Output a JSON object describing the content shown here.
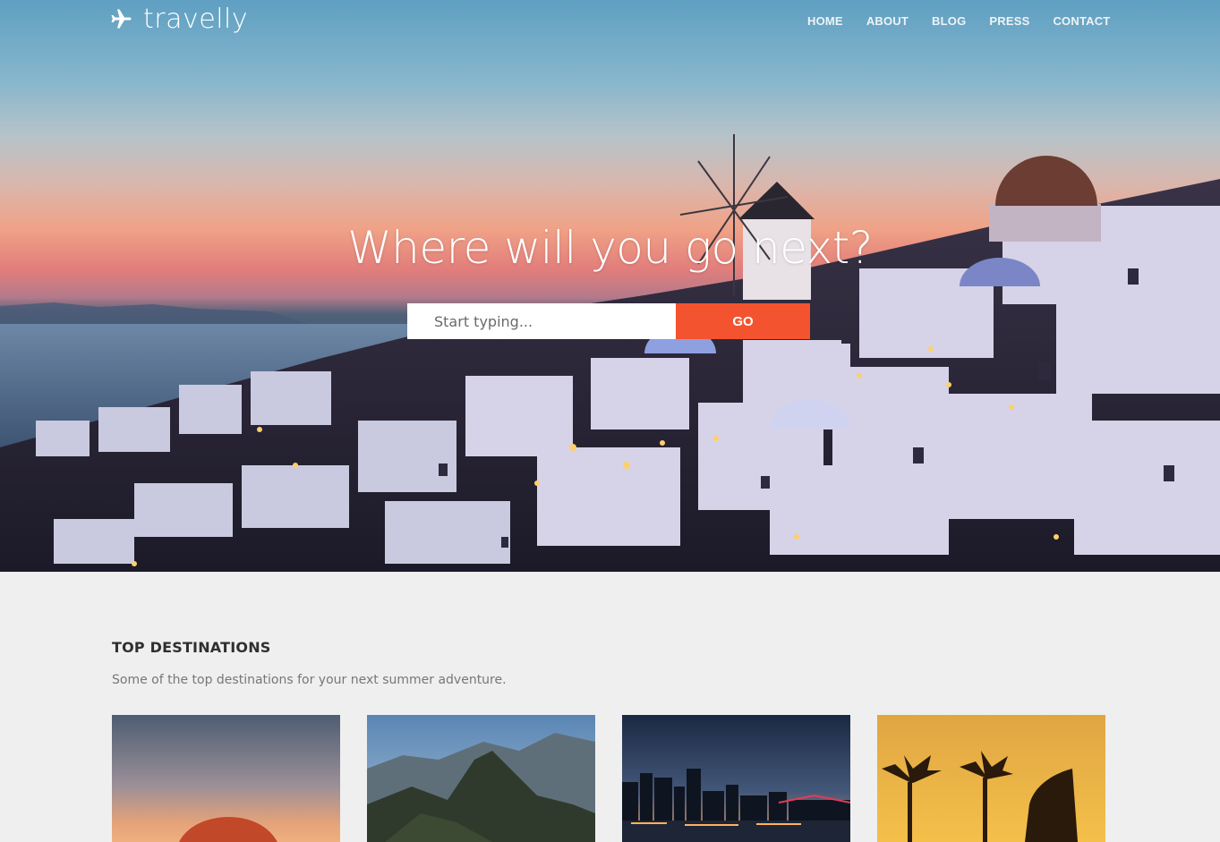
{
  "header": {
    "brand": "travelly",
    "logo_icon": "airplane-icon",
    "nav": [
      "HOME",
      "ABOUT",
      "BLOG",
      "PRESS",
      "CONTACT"
    ]
  },
  "hero": {
    "headline": "Where will you go next?",
    "search_placeholder": "Start typing...",
    "go_label": "GO"
  },
  "destinations": {
    "title": "TOP DESTINATIONS",
    "subtitle": "Some of the top destinations for your next summer adventure.",
    "cards": [
      "uluru-photo",
      "machu-picchu-photo",
      "city-skyline-photo",
      "palm-trees-sunset-photo"
    ]
  },
  "colors": {
    "accent": "#f4532f",
    "page_bg": "#efefef",
    "heading": "#2f2f2f",
    "muted": "#777777"
  }
}
